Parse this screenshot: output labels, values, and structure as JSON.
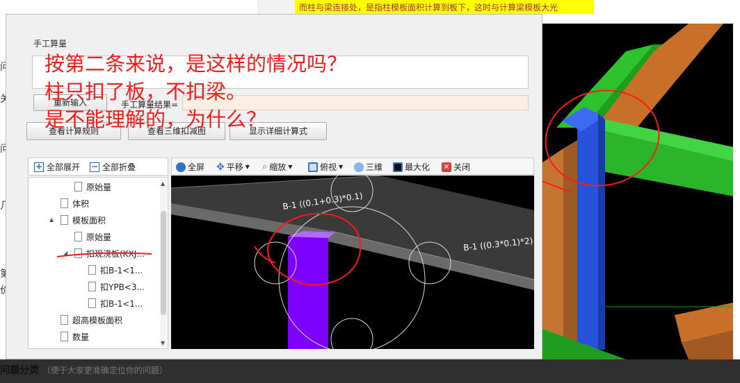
{
  "background": {
    "top_banner": "而柱与梁连接处，是指柱模板面积计算到板下，这时与计算梁模板大光",
    "left_chars": [
      "问",
      "关",
      "问",
      "几",
      "第",
      "价"
    ]
  },
  "dialog": {
    "section_title": "手工算量",
    "reinput_button": "重新输入",
    "result_label": "手工算量结果=",
    "result_value": "",
    "view_rules_button": "查看计算规则",
    "view_3d_button": "查看三维扣减图",
    "show_detail_button": "显示详细计算式"
  },
  "tree_toolbar": {
    "expand_all": "全部展开",
    "collapse_all": "全部折叠"
  },
  "tree": [
    {
      "label": "原始量",
      "level": 2,
      "expander": ""
    },
    {
      "label": "体积",
      "level": 1,
      "expander": ""
    },
    {
      "label": "模板面积",
      "level": 1,
      "expander": "▲"
    },
    {
      "label": "原始量",
      "level": 2,
      "expander": ""
    },
    {
      "label": "扣现浇板(KXJ...",
      "level": 2,
      "expander": "◢"
    },
    {
      "label": "扣B-1<1...",
      "level": 3,
      "expander": ""
    },
    {
      "label": "扣YPB<3...",
      "level": 3,
      "expander": ""
    },
    {
      "label": "扣B-1<1...",
      "level": 3,
      "expander": ""
    },
    {
      "label": "超高模板面积",
      "level": 1,
      "expander": ""
    },
    {
      "label": "数量",
      "level": 1,
      "expander": ""
    }
  ],
  "viewer_toolbar": {
    "fullscreen": "全屏",
    "pan": "平移",
    "zoom": "缩放",
    "top_view": "俯视",
    "three_d": "三维",
    "maximize": "最大化",
    "close": "关闭"
  },
  "viewer": {
    "label_left": "B-1 ((0.1+0.3)*0.1)",
    "label_right": "B-1 ((0.3*0.1)*2)"
  },
  "annotation": {
    "line1": "按第二条来说，是这样的情况吗？",
    "line2": "柱只扣了板，不扣梁。",
    "line3": "是不能理解的，为什么？"
  },
  "bottom": {
    "title": "问题分类",
    "hint": "（便于大家更准确定位你的问题）"
  },
  "colors": {
    "annotation_red": "#ff1a1a",
    "column_purple": "#7d00ff",
    "beam_green": "#22b822",
    "column_blue": "#1e4fd8",
    "wood_orange": "#c8702a",
    "result_field": "#fbefe3"
  }
}
